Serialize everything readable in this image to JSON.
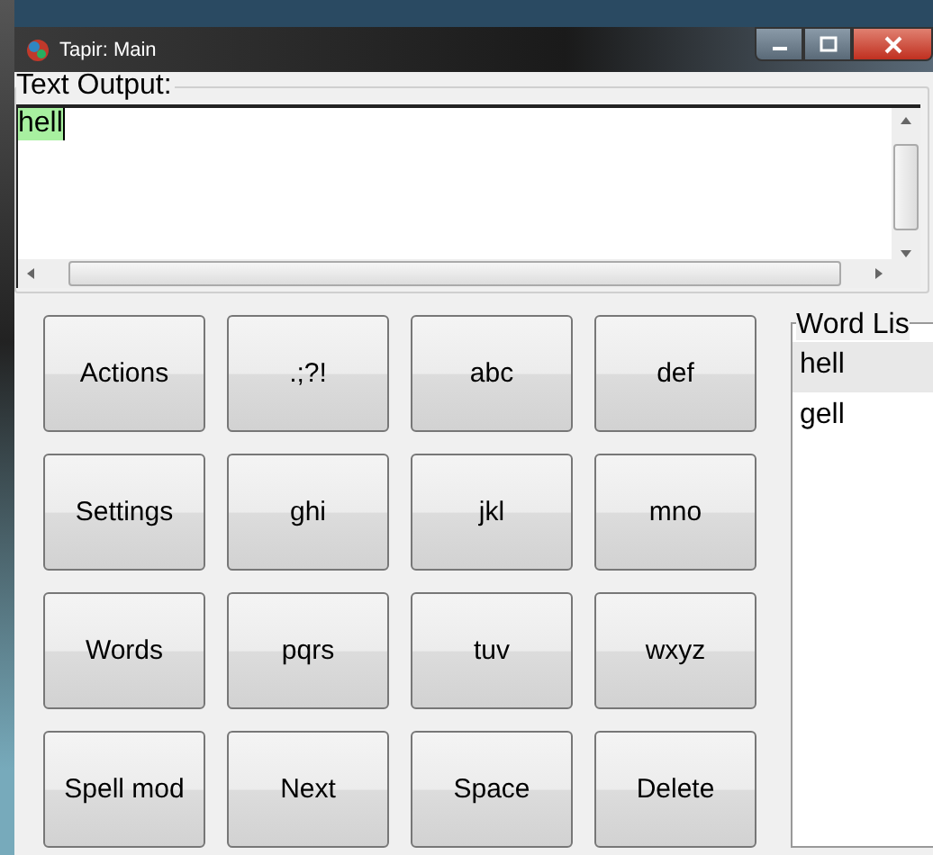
{
  "window": {
    "title": "Tapir: Main"
  },
  "text_output": {
    "label": "Text Output:",
    "value": "hell",
    "highlighted": true
  },
  "keys": [
    {
      "label": "Actions"
    },
    {
      "label": ".;?!"
    },
    {
      "label": "abc"
    },
    {
      "label": "def"
    },
    {
      "label": "Settings"
    },
    {
      "label": "ghi"
    },
    {
      "label": "jkl"
    },
    {
      "label": "mno"
    },
    {
      "label": "Words"
    },
    {
      "label": "pqrs"
    },
    {
      "label": "tuv"
    },
    {
      "label": "wxyz"
    },
    {
      "label": "Spell mod"
    },
    {
      "label": "Next"
    },
    {
      "label": "Space"
    },
    {
      "label": "Delete"
    }
  ],
  "word_list": {
    "label": "Word Lis",
    "items": [
      {
        "text": "hell",
        "selected": true
      },
      {
        "text": "gell",
        "selected": false
      }
    ]
  }
}
